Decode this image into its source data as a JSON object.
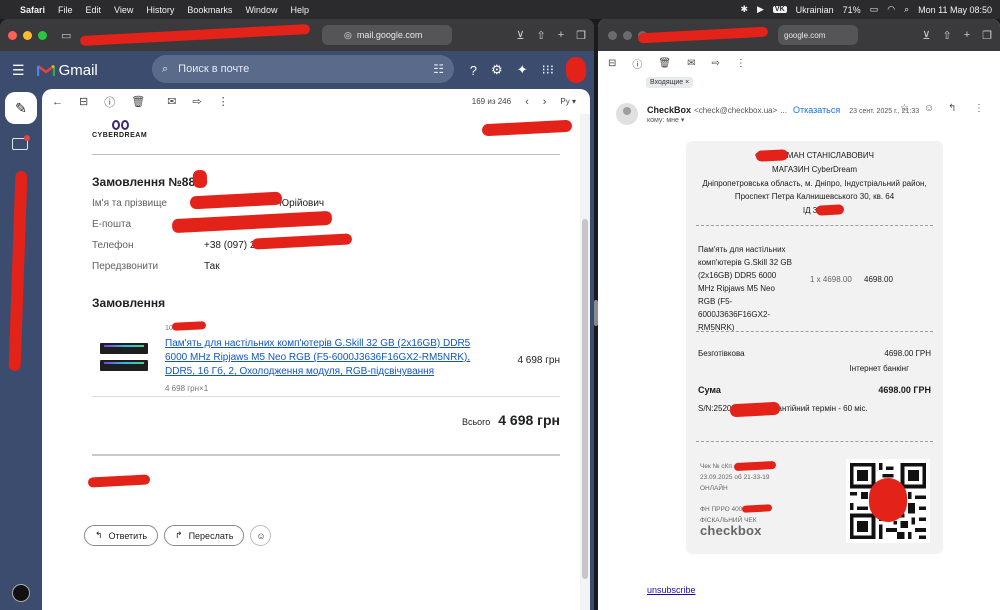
{
  "menubar": {
    "items": [
      "Safari",
      "File",
      "Edit",
      "View",
      "History",
      "Bookmarks",
      "Window",
      "Help"
    ],
    "keyboard_badge": "VK",
    "keyboard_layout": "Ukrainian",
    "battery": "71%",
    "datetime": "Mon 11 May  08:50"
  },
  "left_browser": {
    "url": "mail.google.com"
  },
  "gmail": {
    "logo": "Gmail",
    "search_placeholder": "Поиск в почте",
    "pager": "169 из 246",
    "lang": "Ру"
  },
  "email": {
    "brand": "CYBERDREAM",
    "order_title": "Замовлення №88",
    "fields": [
      {
        "label": "Ім'я та прізвище",
        "value": "Юрійович"
      },
      {
        "label": "E-пошта",
        "value": ""
      },
      {
        "label": "Телефон",
        "value": "+38 (097) 2"
      },
      {
        "label": "Передзвонити",
        "value": "Так"
      }
    ],
    "section_title": "Замовлення",
    "product": {
      "sku": "10",
      "name": "Пам'ять для настільних комп'ютерів G.Skill 32 GB (2x16GB) DDR5 6000 MHz Ripjaws M5 Neo RGB (F5-6000J3636F16GX2-RM5NRK), DDR5, 16 Гб, 2, Охолодження модуля, RGB-підсвічування",
      "price": "4 698 грн",
      "qty_line": "4 698 грн×1"
    },
    "total_label": "Всього",
    "total_value": "4 698 грн",
    "reply_button": "Ответить",
    "forward_button": "Переслать"
  },
  "right_browser": {
    "url": "google.com",
    "label_chip": "Входящие",
    "sender_name": "CheckBox",
    "sender_email": "<check@checkbox.ua>",
    "unsubscribe_short": "Отказаться",
    "date": "23 сент. 2025 г., 21:33",
    "to": "кому: мне",
    "unsubscribe_link": "unsubscribe"
  },
  "receipt": {
    "owner": "ФОП        РОМАН СТАНІСЛАВОВИЧ",
    "shop": "МАГАЗИН CyberDream",
    "address1": "Дніпропетровська область, м. Дніпро, Індустріальний район,",
    "address2": "Проспект Петра Калнишевського 30, кв. 64",
    "id": "ІД 333",
    "item": "Пам'ять для настільних комп'ютерів G.Skill 32 GB (2x16GB) DDR5 6000 MHz Ripjaws M5 Neo RGB (F5-6000J3636F16GX2-RM5NRK)",
    "item_qty": "1 x 4698.00",
    "item_sum": "4698.00",
    "payment_label": "Безготівкова",
    "payment_value": "4698.00   ГРН",
    "payment_method": "Інтернет банкінг",
    "sum_label": "Сума",
    "sum_value": "4698.00   ГРН",
    "sn_line": "S/N:25202        /2520        ; Гарантійний термін - 60 міс.",
    "check_no": "Чек № сКп",
    "check_date": "23.09.2025 об 21-33-19",
    "online": "ОНЛАЙН",
    "fn": "ФН ПРРО 4000",
    "fiscal": "ФІСКАЛЬНИЙ ЧЕК",
    "logo": "checkbox"
  },
  "colors": {
    "gmail_bg": "#3b4c6e",
    "link": "#1155cc",
    "redaction": "#e32219"
  }
}
